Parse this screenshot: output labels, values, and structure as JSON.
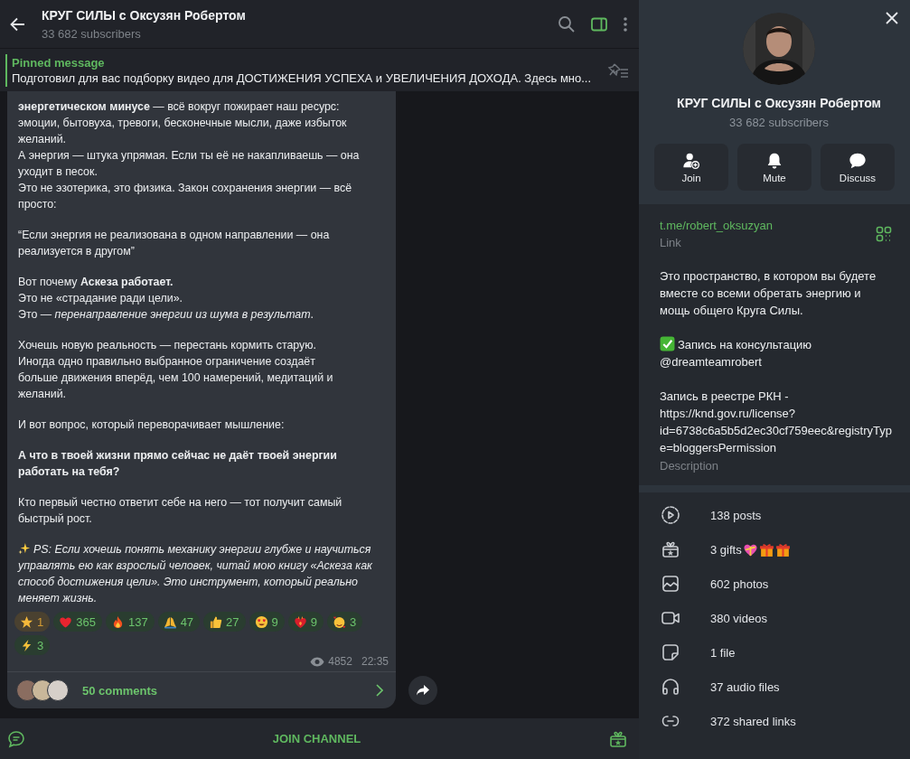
{
  "header": {
    "title": "КРУГ СИЛЫ с Оксузян Робертом",
    "subtitle": "33 682 subscribers"
  },
  "pinned": {
    "label": "Pinned message",
    "text": "Подготовил для вас подборку видео для ДОСТИЖЕНИЯ УСПЕХА и УВЕЛИЧЕНИЯ ДОХОДА.  Здесь мно..."
  },
  "message": {
    "paragraphs": [
      {
        "kind": "text",
        "text": "**энергетическом минусе** — всё вокруг пожирает наш ресурс:\nэмоции, бытовуха, тревоги, бесконечные мысли, даже избыток\nжеланий.\nА энергия — штука упрямая. Если ты её не накапливаешь — она\nуходит в песок.\nЭто не эзотерика, это физика. Закон сохранения энергии — всё\nпросто:"
      },
      {
        "kind": "text",
        "text": "“Если энергия не реализована в одном направлении — она\nреализуется в другом”"
      },
      {
        "kind": "text",
        "text": "Вот почему **Аскеза работает.**\nЭто не «страдание ради цели».\nЭто — *перенаправление энергии из шума в результат*."
      },
      {
        "kind": "text",
        "text": "Хочешь новую реальность — перестань кормить старую.\nИногда одно правильно выбранное ограничение создаёт\nбольше движения вперёд, чем 100 намерений, медитаций и\nжеланий."
      },
      {
        "kind": "text",
        "text": "И вот вопрос, который переворачивает мышление:"
      },
      {
        "kind": "bold",
        "text": "А что в твоей жизни прямо сейчас не даёт твоей энергии\nработать на тебя?"
      },
      {
        "kind": "text",
        "text": "Кто первый честно ответит себе на него — тот получит самый\nбыстрый рост."
      },
      {
        "kind": "ps",
        "text": "PS: Если хочешь понять механику энергии глубже и научиться\nуправлять ею как взрослый человек, читай мою книгу «Аскеза как\nспособ достижения цели». Это инструмент, который реально\nменяет жизнь."
      }
    ],
    "reactions": [
      {
        "kind": "star",
        "count": "1"
      },
      {
        "kind": "heart",
        "count": "365"
      },
      {
        "kind": "fire",
        "count": "137"
      },
      {
        "kind": "pray",
        "count": "47"
      },
      {
        "kind": "thumbs",
        "count": "27"
      },
      {
        "kind": "heart_eyes",
        "count": "9"
      },
      {
        "kind": "heart_fire",
        "count": "9"
      },
      {
        "kind": "hearts_face",
        "count": "3"
      },
      {
        "kind": "zap",
        "count": "3"
      }
    ],
    "views": "4852",
    "time": "22:35",
    "comments": "50 comments"
  },
  "footer": {
    "join": "JOIN CHANNEL"
  },
  "profile": {
    "name": "КРУГ СИЛЫ с Оксузян Робертом",
    "subscribers": "33 682 subscribers",
    "actions": [
      {
        "kind": "join",
        "label": "Join"
      },
      {
        "kind": "mute",
        "label": "Mute"
      },
      {
        "kind": "discuss",
        "label": "Discuss"
      }
    ],
    "link": {
      "value": "t.me/robert_oksuzyan",
      "label": "Link"
    },
    "description": {
      "intro": "Это пространство, в котором вы будете\nвместе со всеми обретать энергию и\nмощь общего Круга Силы.",
      "consult": "Запись на консультацию",
      "handle": "@dreamteamrobert",
      "registry": "Запись в реестре РКН -",
      "url": "https://knd.gov.ru/license?id=6738c6a5b5d2ec30cf759eec&registryType=bloggersPermission",
      "label": "Description"
    },
    "stats": [
      {
        "kind": "posts",
        "text": "138 posts"
      },
      {
        "kind": "gifts",
        "text": "3 gifts"
      },
      {
        "kind": "photos",
        "text": "602 photos"
      },
      {
        "kind": "videos",
        "text": "380 videos"
      },
      {
        "kind": "files",
        "text": "1 file"
      },
      {
        "kind": "audio",
        "text": "37 audio files"
      },
      {
        "kind": "links",
        "text": "372 shared links"
      }
    ]
  }
}
